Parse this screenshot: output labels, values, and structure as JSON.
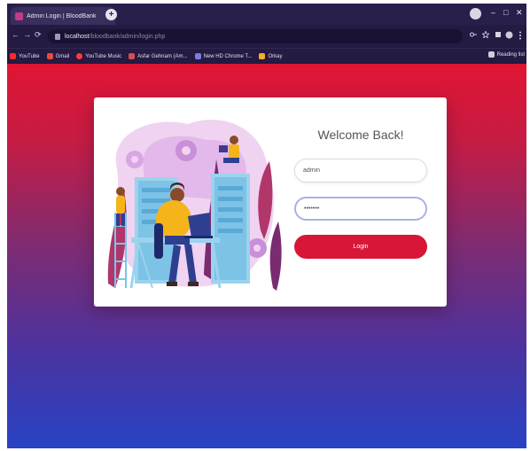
{
  "browser": {
    "tab_title": "Admin Login | BloodBank",
    "tab_close": "×",
    "new_tab": "+",
    "window_controls": {
      "minimize": "–",
      "maximize": "□",
      "close": "✕"
    },
    "nav": {
      "back": "←",
      "forward": "→",
      "reload": "⟳"
    },
    "url_host": "localhost",
    "url_path": "/bloodbank/admin/login.php",
    "bookmarks": [
      {
        "label": "YouTube",
        "color": "#ff2a2a"
      },
      {
        "label": "Gmail",
        "color": "#e84c3d"
      },
      {
        "label": "YouTube Music",
        "color": "#ff3b3b"
      },
      {
        "label": "Asfar Gehnam (Am...",
        "color": "#d94d4d"
      },
      {
        "label": "New HD Chrome T...",
        "color": "#7c7ce0"
      },
      {
        "label": "Orkay",
        "color": "#f2b024"
      }
    ],
    "reading_list": "Reading list"
  },
  "login": {
    "heading": "Welcome Back!",
    "username_value": "admin",
    "password_value": "•••••••",
    "button_label": "Login"
  },
  "colors": {
    "gradient_top": "#e11533",
    "gradient_bottom": "#2843c4",
    "button": "#d71638",
    "browser_chrome": "#241a42"
  }
}
